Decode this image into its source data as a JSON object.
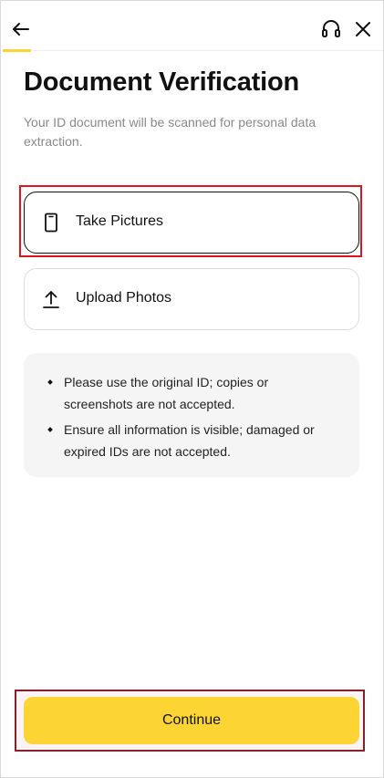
{
  "header": {
    "back_icon": "arrow-left-icon",
    "support_icon": "headset-icon",
    "close_icon": "close-icon",
    "progress_fraction": 0.08,
    "accent": "#FCD535"
  },
  "page": {
    "title": "Document Verification",
    "subtitle": "Your ID document will be scanned for personal data extraction."
  },
  "options": [
    {
      "label": "Take Pictures",
      "icon": "phone-icon",
      "selected": true
    },
    {
      "label": "Upload Photos",
      "icon": "upload-icon",
      "selected": false
    }
  ],
  "notice": {
    "items": [
      "Please use the original ID; copies or screenshots are not accepted.",
      "Ensure all information is visible; damaged or expired IDs are not accepted."
    ]
  },
  "footer": {
    "continue_label": "Continue"
  },
  "colors": {
    "highlight": "#e0141e",
    "primary_button": "#FCD535"
  }
}
